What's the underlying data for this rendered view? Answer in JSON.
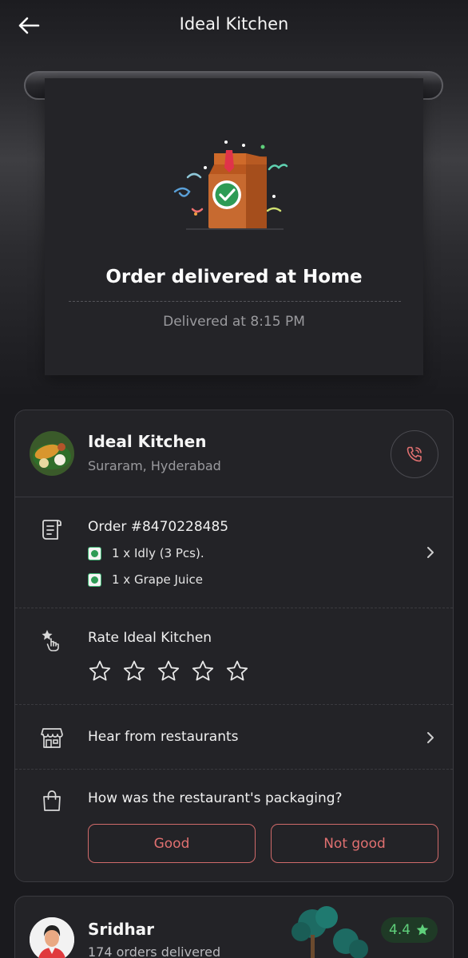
{
  "header": {
    "title": "Ideal Kitchen"
  },
  "status": {
    "title": "Order delivered at Home",
    "time": "Delivered at 8:15 PM"
  },
  "restaurant": {
    "name": "Ideal Kitchen",
    "location": "Suraram, Hyderabad"
  },
  "order": {
    "number": "Order #8470228485",
    "items": [
      {
        "text": "1 x Idly (3 Pcs)."
      },
      {
        "text": "1 x Grape Juice"
      }
    ]
  },
  "rating": {
    "title": "Rate Ideal Kitchen",
    "max_stars": 5,
    "selected_stars": 0
  },
  "hear": {
    "label": "Hear from restaurants"
  },
  "packaging": {
    "question": "How was the restaurant's packaging?",
    "good_label": "Good",
    "not_good_label": "Not good"
  },
  "rider": {
    "name": "Sridhar",
    "orders": "174 orders delivered",
    "rating": "4.4"
  },
  "colors": {
    "background": "#1a1a1e",
    "card": "#232327",
    "accent_red": "#e07070",
    "rating_green": "#5fd07b",
    "veg_green": "#2e9b55"
  },
  "icons": {
    "back": "arrow-left-icon",
    "call": "phone-icon",
    "order": "receipt-icon",
    "rate": "star-tap-icon",
    "hear": "storefront-icon",
    "packaging": "shopping-bag-icon",
    "chevron": "chevron-right-icon",
    "rating_star": "star-icon"
  }
}
